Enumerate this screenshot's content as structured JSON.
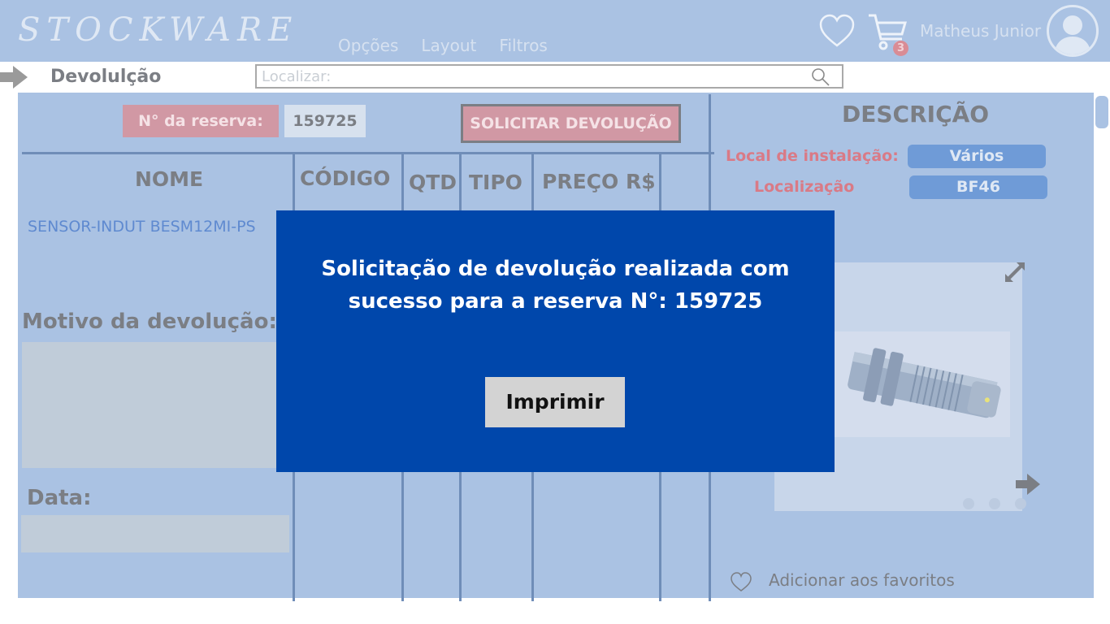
{
  "header": {
    "logo": "STOCKWARE",
    "menu": [
      "Opções",
      "Layout",
      "Filtros"
    ],
    "cart_count": "3",
    "username": "Matheus Junior"
  },
  "subbar": {
    "page_title": "Devolulção",
    "search_placeholder": "Localizar:"
  },
  "reservation": {
    "label": "N° da reserva:",
    "value": "159725",
    "action_label": "SOLICITAR DEVOLUÇÃO"
  },
  "table": {
    "columns": [
      "NOME",
      "CÓDIGO",
      "QTD",
      "TIPO",
      "PREÇO R$"
    ],
    "rows": [
      {
        "name": "SENSOR-INDUT BESM12MI-PS"
      }
    ]
  },
  "form": {
    "motivo_label": "Motivo da devolução:",
    "data_label": "Data:"
  },
  "description": {
    "title": "DESCRIÇÃO",
    "fields": [
      {
        "label": "Local de instalação:",
        "value": "Vários"
      },
      {
        "label": "Localização",
        "value": "BF46"
      }
    ],
    "favorite_label": "Adicionar aos favoritos"
  },
  "modal": {
    "message": "Solicitação de devolução realizada com\nsucesso para a reserva N°: 159725",
    "button_label": "Imprimir"
  },
  "colors": {
    "header_bg": "#aac2e3",
    "modal_bg": "#0047ab",
    "accent_red": "#d198a4",
    "pill_blue": "#6f9bd7"
  },
  "icons": [
    "arrow-right-icon",
    "search-icon",
    "heart-icon",
    "cart-icon",
    "user-avatar-icon",
    "expand-icon",
    "next-arrow-icon"
  ]
}
